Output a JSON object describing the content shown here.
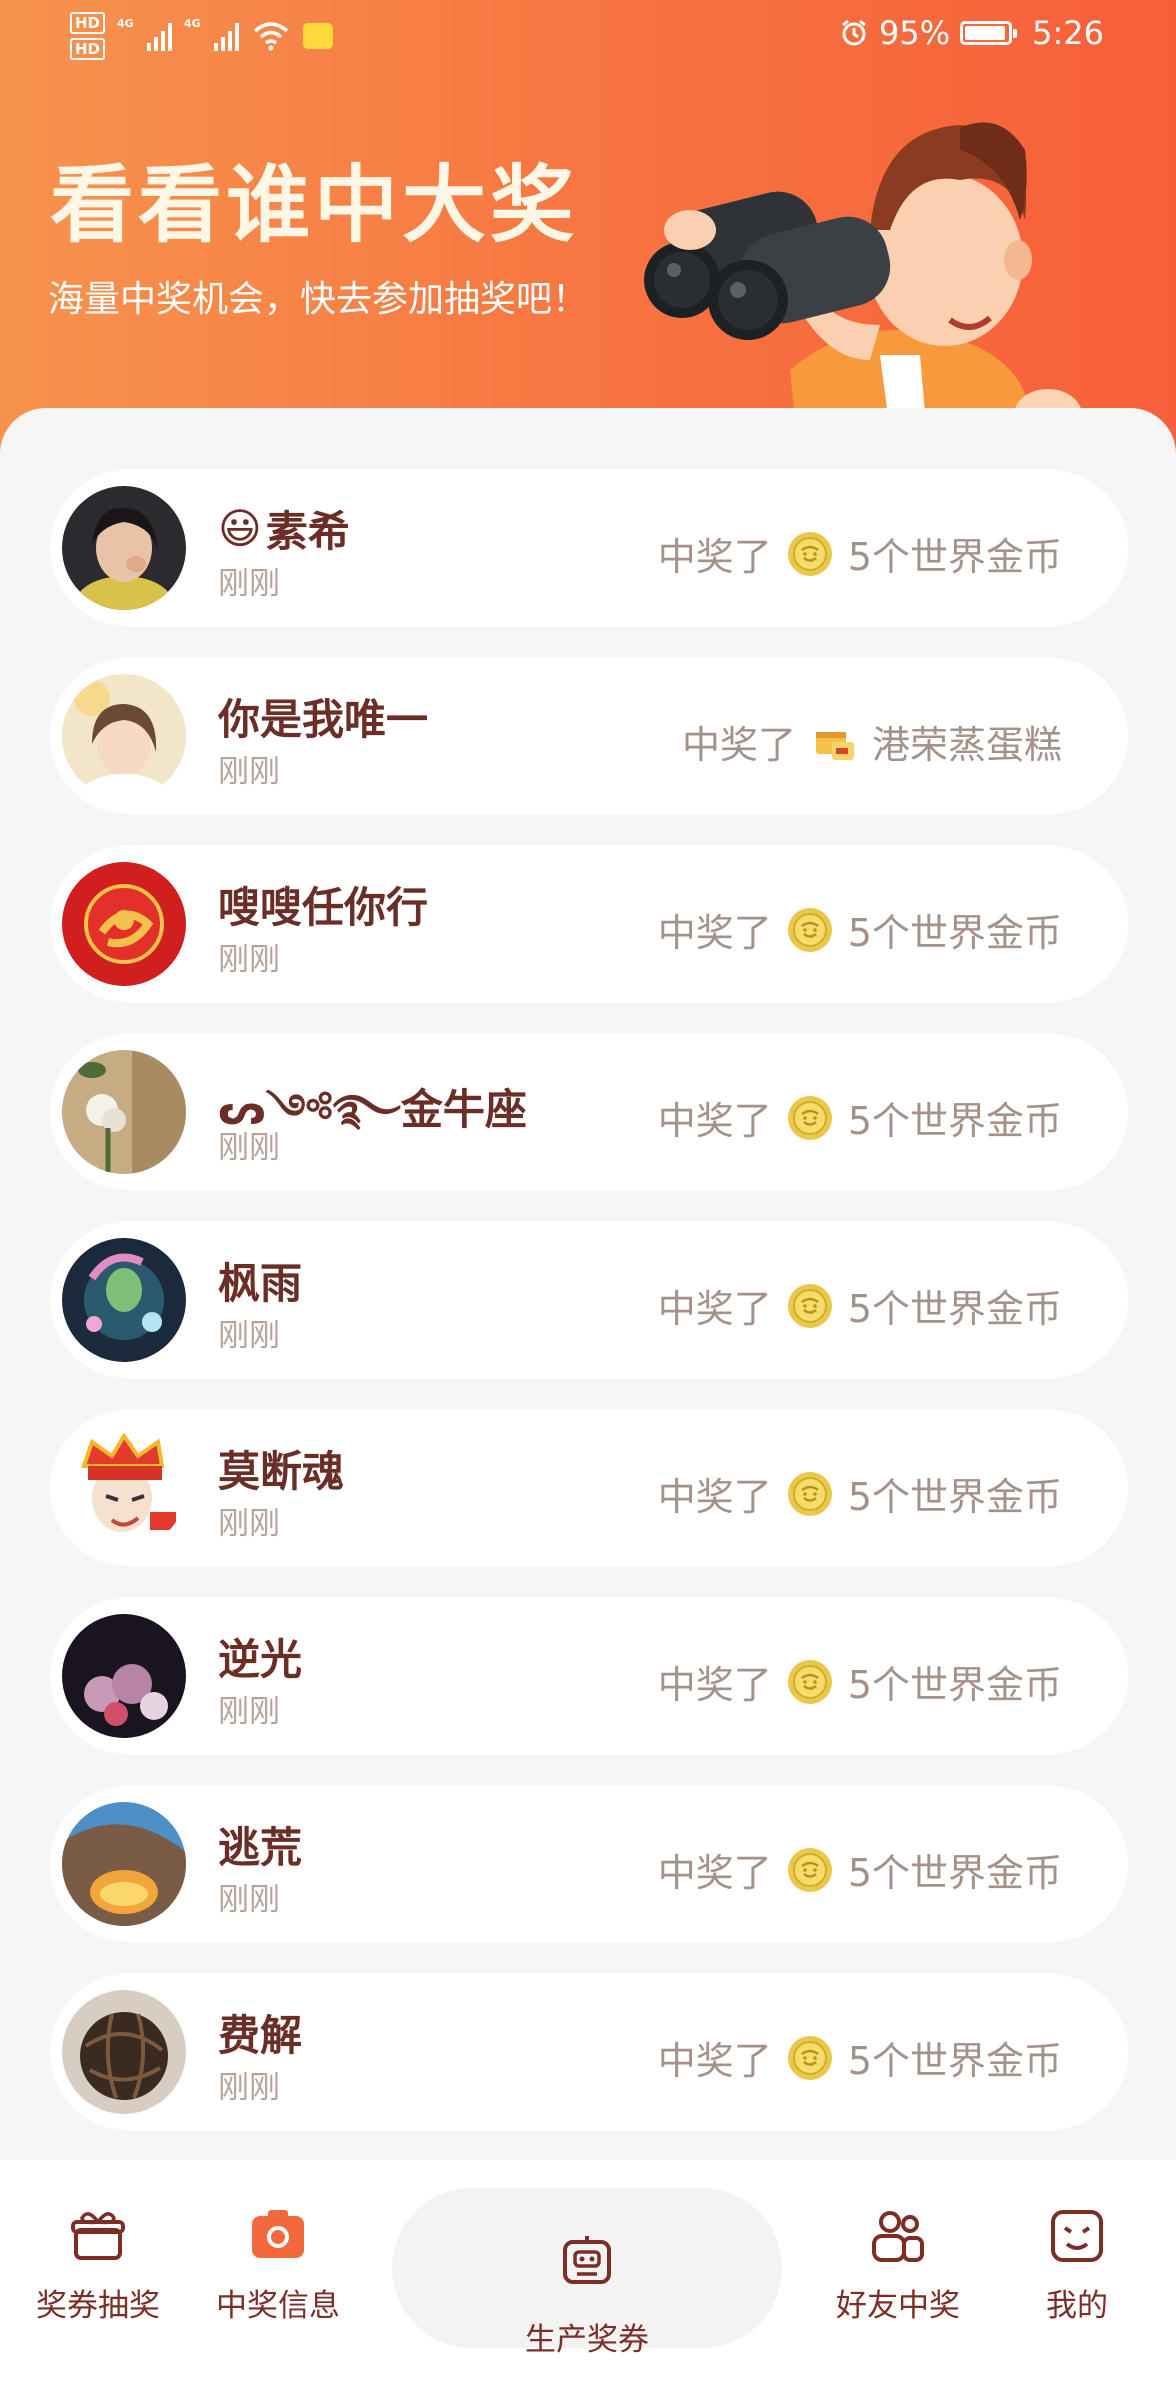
{
  "status_bar": {
    "hd1": "HD",
    "hd2": "HD",
    "net1": "4G",
    "net2": "4G",
    "battery_pct": "95%",
    "battery_level": 0.95,
    "time": "5:26"
  },
  "hero": {
    "title": "看看谁中大奖",
    "subtitle": "海量中奖机会，快去参加抽奖吧！"
  },
  "win_prefix": "中奖了",
  "winners": [
    {
      "name": "素希",
      "emoji": "😃",
      "time": "刚刚",
      "prize": "5个世界金币",
      "prize_icon": "coin-icon"
    },
    {
      "name": "你是我唯一",
      "time": "刚刚",
      "prize": "港荣蒸蛋糕",
      "prize_icon": "cake-icon"
    },
    {
      "name": "嗖嗖任你行",
      "time": "刚刚",
      "prize": "5个世界金币",
      "prize_icon": "coin-icon"
    },
    {
      "name": "ᔕ༺࿐金牛座",
      "time": "刚刚",
      "prize": "5个世界金币",
      "prize_icon": "coin-icon"
    },
    {
      "name": "枫雨",
      "time": "刚刚",
      "prize": "5个世界金币",
      "prize_icon": "coin-icon"
    },
    {
      "name": "莫断魂",
      "time": "刚刚",
      "prize": "5个世界金币",
      "prize_icon": "coin-icon"
    },
    {
      "name": "逆光",
      "time": "刚刚",
      "prize": "5个世界金币",
      "prize_icon": "coin-icon"
    },
    {
      "name": "逃荒",
      "time": "刚刚",
      "prize": "5个世界金币",
      "prize_icon": "coin-icon"
    },
    {
      "name": "费解",
      "time": "刚刚",
      "prize": "5个世界金币",
      "prize_icon": "coin-icon"
    }
  ],
  "tabs": [
    {
      "label": "奖券抽奖",
      "icon": "gift-box-icon"
    },
    {
      "label": "中奖信息",
      "icon": "camera-icon"
    },
    {
      "label": "生产奖券",
      "icon": "robot-icon"
    },
    {
      "label": "好友中奖",
      "icon": "friends-icon"
    },
    {
      "label": "我的",
      "icon": "smile-face-icon"
    }
  ],
  "colors": {
    "header_start": "#f7934d",
    "header_end": "#f75f3a",
    "name_text": "#6b2e26",
    "muted_text": "#a4928a",
    "accent": "#f4683e"
  }
}
